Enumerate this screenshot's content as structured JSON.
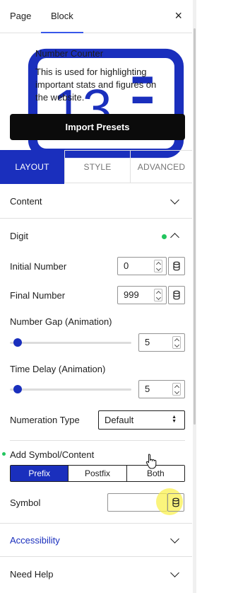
{
  "tabs": {
    "page": "Page",
    "block": "Block",
    "close": "×"
  },
  "block_card": {
    "icon": "number-counter-icon",
    "title": "Number Counter",
    "description": "This is used for highlighting important stats and figures on the website.",
    "import_button": "Import Presets"
  },
  "settings_tabs": {
    "layout": "LAYOUT",
    "style": "STYLE",
    "advanced": "ADVANCED"
  },
  "panels": {
    "content": "Content",
    "digit": "Digit",
    "accessibility": "Accessibility",
    "need_help": "Need Help"
  },
  "digit": {
    "initial_label": "Initial Number",
    "initial_value": "0",
    "final_label": "Final Number",
    "final_value": "999",
    "gap_label": "Number Gap (Animation)",
    "gap_value": "5",
    "delay_label": "Time Delay (Animation)",
    "delay_value": "5",
    "numeration_label": "Numeration Type",
    "numeration_value": "Default",
    "symbol_label": "Add Symbol/Content",
    "symbol_options": [
      "Prefix",
      "Postfix",
      "Both"
    ],
    "symbol_field_label": "Symbol",
    "symbol_value": ""
  },
  "colors": {
    "accent": "#1a2fbd",
    "dot": "#22c55e",
    "button": "#0b0b0b"
  }
}
